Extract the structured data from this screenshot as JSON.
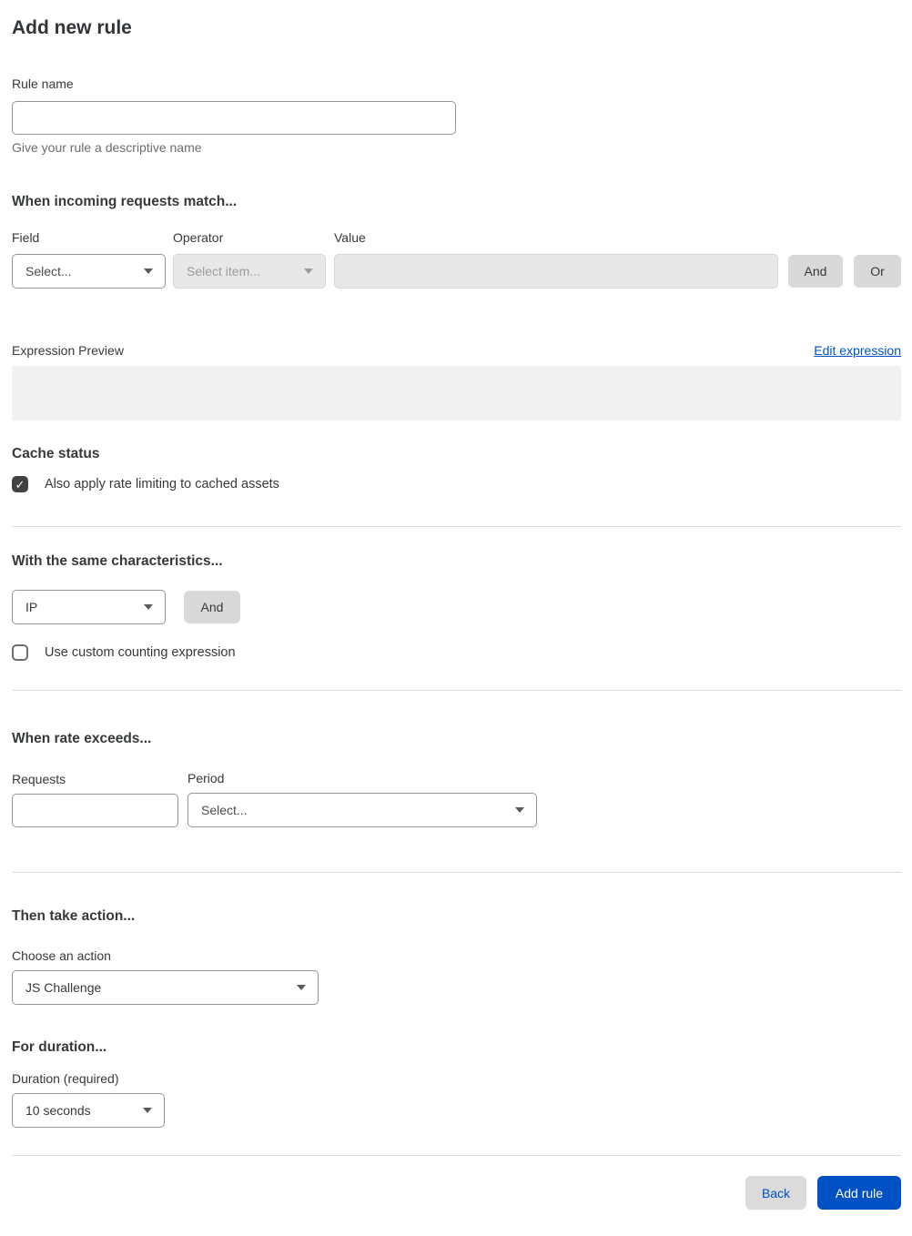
{
  "colors": {
    "accent_blue": "#0051c3",
    "button_gray": "#d9d9d9",
    "disabled_bg": "#e8e8e8",
    "preview_bg": "#f1f1f2",
    "checkbox_checked": "#424242"
  },
  "icons": {
    "check": "✓",
    "caret_down": "▾"
  },
  "page": {
    "title": "Add new rule"
  },
  "rule_name": {
    "label": "Rule name",
    "value": "",
    "helper": "Give your rule a descriptive name"
  },
  "match": {
    "heading": "When incoming requests match...",
    "field_label": "Field",
    "field_value": "Select...",
    "operator_label": "Operator",
    "operator_value": "Select item...",
    "operator_disabled": true,
    "value_label": "Value",
    "value_text": "",
    "value_disabled": true,
    "and_label": "And",
    "or_label": "Or"
  },
  "expression": {
    "label": "Expression Preview",
    "edit_link": "Edit expression",
    "preview_text": ""
  },
  "cache": {
    "heading": "Cache status",
    "checkbox_label": "Also apply rate limiting to cached assets",
    "checked": true
  },
  "characteristics": {
    "heading": "With the same characteristics...",
    "select_value": "IP",
    "and_label": "And",
    "counting_checkbox_label": "Use custom counting expression",
    "counting_checked": false
  },
  "rate": {
    "heading": "When rate exceeds...",
    "requests_label": "Requests",
    "requests_value": "",
    "period_label": "Period",
    "period_value": "Select..."
  },
  "action": {
    "heading": "Then take action...",
    "label": "Choose an action",
    "value": "JS Challenge"
  },
  "duration": {
    "heading": "For duration...",
    "label": "Duration (required)",
    "value": "10 seconds"
  },
  "footer": {
    "back": "Back",
    "submit": "Add rule"
  }
}
